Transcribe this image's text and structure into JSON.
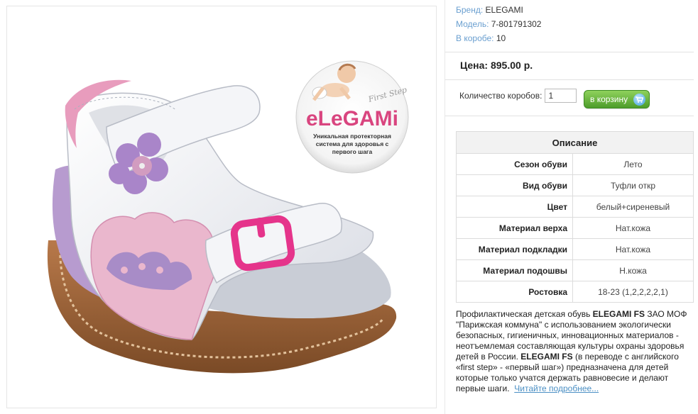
{
  "product": {
    "image_alt": "Детская сандалия ELEGAMI",
    "logo": {
      "brand_text": "eLeGAMi",
      "tag_text": "First Step",
      "caption_lines": [
        "Уникальная протекторная",
        "система для здоровья с",
        "первого шага"
      ]
    },
    "meta": {
      "brand_label": "Бренд:",
      "brand_value": "ELEGAMI",
      "model_label": "Модель:",
      "model_value": "7-801791302",
      "box_label": "В коробе:",
      "box_value": "10"
    },
    "price_text": "Цена: 895.00 р.",
    "quantity": {
      "label": "Количество коробов:",
      "value": "1"
    },
    "cart_button_label": "в корзину"
  },
  "description": {
    "heading": "Описание",
    "rows": [
      {
        "key": "Сезон обуви",
        "value": "Лето"
      },
      {
        "key": "Вид обуви",
        "value": "Туфли откр"
      },
      {
        "key": "Цвет",
        "value": "белый+сиреневый"
      },
      {
        "key": "Материал верха",
        "value": "Нат.кожа"
      },
      {
        "key": "Материал подкладки",
        "value": "Нат.кожа"
      },
      {
        "key": "Материал подошвы",
        "value": "Н.кожа"
      },
      {
        "key": "Ростовка",
        "value": "18-23 (1,2,2,2,2,1)"
      }
    ],
    "blurb": {
      "p1": "Профилактическая детская обувь ",
      "b1": "ELEGAMI FS",
      "p2": " ЗАО МОФ \"Парижская коммуна\" с использованием экологически безопасных, гигиеничных, инновационных материалов - неотъемлемая составляющая культуры охраны здоровья детей в России. ",
      "b2": "ELEGAMI FS",
      "p3": " (в переводе с английского «first step» - «первый шаг») предназначена для детей которые только учатся держать равновесие и делают первые шаги.",
      "read_more": "Читайте подробнее..."
    }
  },
  "colors": {
    "link_blue": "#4a8fc4",
    "label_blue": "#6a9fd0",
    "cart_green": "#4d9c2b",
    "logo_pink": "#d9457f"
  }
}
